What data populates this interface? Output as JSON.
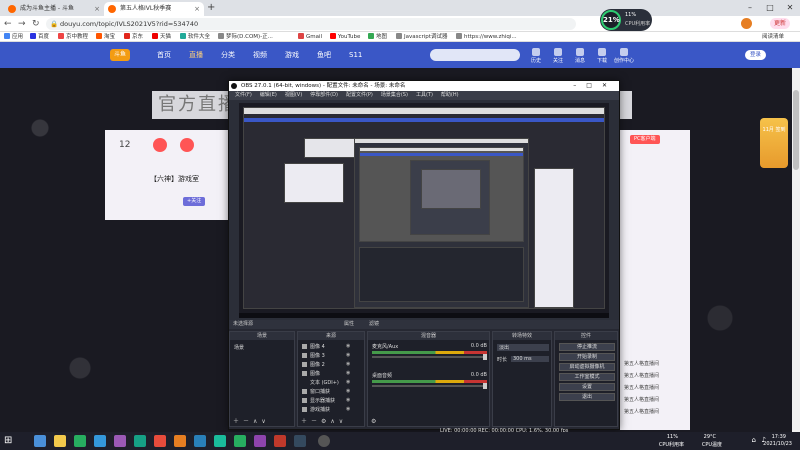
{
  "browser": {
    "tabs": [
      {
        "label": "成为斗鱼主播 - 斗鱼"
      },
      {
        "label": "第五人格IVL秋季赛"
      }
    ],
    "url": "douyu.com/topic/IVLS2021V5?rid=534740",
    "account_label": "更新",
    "bookmarks": [
      "应用",
      "百度",
      "京中教程",
      "淘宝",
      "京东",
      "天猫",
      "软件大全",
      "梦际(D.COM)-正...",
      "Gmail",
      "YouTube",
      "地图",
      "Javascript调试器",
      "https://www.zhiqi...",
      "阅读清单"
    ]
  },
  "cpu_meter": {
    "percent": "21%",
    "line1": "11%",
    "line2": "CPU利用率"
  },
  "site": {
    "logo": "斗鱼",
    "nav": [
      "首页",
      "直播",
      "分类",
      "视频",
      "游戏",
      "鱼吧",
      "S11"
    ],
    "active_nav": "直播",
    "header_icons": [
      "历史",
      "关注",
      "消息",
      "下载",
      "创作中心"
    ],
    "login": "登录",
    "banner": "官方直播",
    "left_card_num": "12",
    "streamer": "【六神】游戏室",
    "follow_label": "+关注",
    "pc_label": "PC客户端",
    "gift_label": "11月 签到",
    "right_items": [
      "第五人格直播间",
      "第五人格直播间",
      "第五人格直播间",
      "第五人格直播间",
      "第五人格直播间"
    ]
  },
  "obs": {
    "title": "OBS 27.0.1 (64-bit, windows) - 配置文件: 未命名 - 场景: 未命名",
    "menu": [
      "文件(F)",
      "编辑(E)",
      "视图(V)",
      "停靠部件(D)",
      "配置文件(P)",
      "场景集合(S)",
      "工具(T)",
      "帮助(H)"
    ],
    "dock_header": "未选择源",
    "dock_tabs": [
      "属性",
      "滤镜"
    ],
    "docks": {
      "scenes": {
        "title": "场景",
        "items": [
          "场景"
        ]
      },
      "sources": {
        "title": "来源",
        "items": [
          "图像 4",
          "图像 3",
          "图像 2",
          "图像",
          "文本 (GDI+)",
          "窗口捕获",
          "显示器捕获",
          "游戏捕获"
        ]
      },
      "mixer": {
        "title": "混音器",
        "rows": [
          {
            "name": "麦克风/Aux",
            "db": "0.0 dB"
          },
          {
            "name": "桌面音频",
            "db": "0.0 dB"
          }
        ]
      },
      "transitions": {
        "title": "转场特效",
        "type": "淡出",
        "duration_label": "时长",
        "duration": "300 ms"
      },
      "controls": {
        "title": "控件",
        "buttons": [
          "停止推流",
          "开始录制",
          "启动虚拟摄像机",
          "工作室模式",
          "设置",
          "退出"
        ]
      }
    },
    "status": "LIVE: 00:00:00  REC: 00:00:00  CPU: 1.6%, 30.00 fps"
  },
  "taskbar": {
    "cpu_pct": "11%",
    "cpu_label": "CPU利用率",
    "temp": "29°C",
    "temp_label": "CPU温度",
    "time": "17:39",
    "date": "2021/10/23"
  }
}
